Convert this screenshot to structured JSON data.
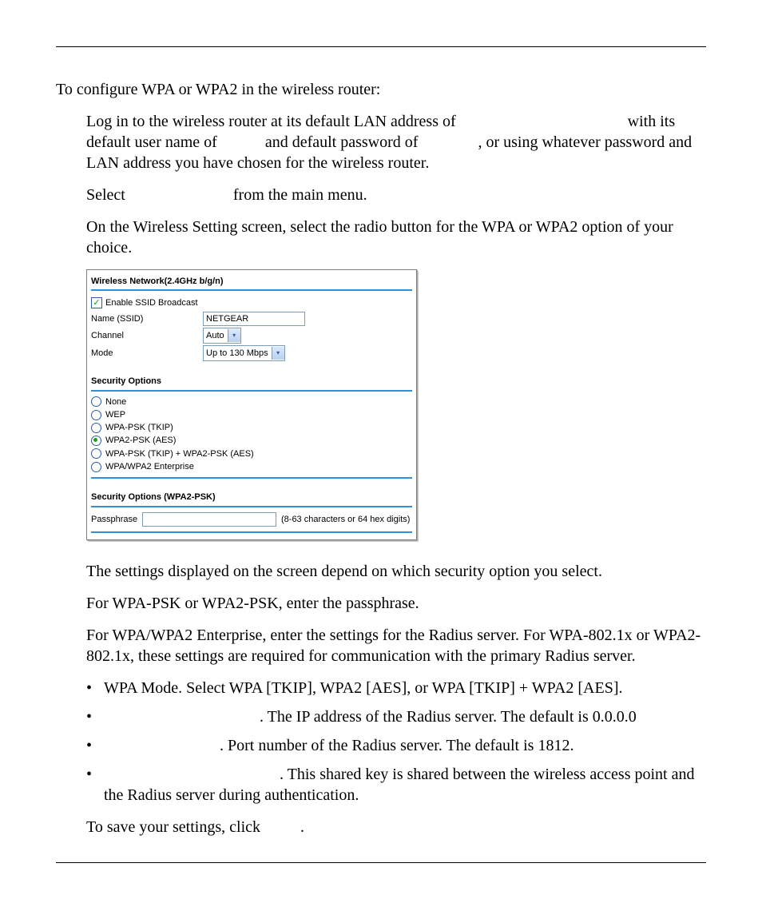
{
  "intro": "To configure WPA or WPA2 in the wireless router:",
  "steps": {
    "s1a": "Log in to the wireless router at its default LAN address of",
    "s1b": "with its default user name of",
    "s1c": "and default password of",
    "s1d": ", or using whatever password and LAN address you have chosen for the wireless router.",
    "s2a": "Select",
    "s2b": "from the main menu.",
    "s3": "On the Wireless Setting screen, select the radio button for the WPA or WPA2 option of your choice."
  },
  "ui": {
    "section1_title": "Wireless Network(2.4GHz b/g/n)",
    "enable_ssid": "Enable SSID Broadcast",
    "name_label": "Name (SSID)",
    "name_value": "NETGEAR",
    "channel_label": "Channel",
    "channel_value": "Auto",
    "mode_label": "Mode",
    "mode_value": "Up to 130 Mbps",
    "security_title": "Security Options",
    "opts": {
      "none": "None",
      "wep": "WEP",
      "wpa_tkip": "WPA-PSK (TKIP)",
      "wpa2_aes": "WPA2-PSK (AES)",
      "both": "WPA-PSK (TKIP) + WPA2-PSK (AES)",
      "enterprise": "WPA/WPA2 Enterprise"
    },
    "section3_title": "Security Options (WPA2-PSK)",
    "passphrase_label": "Passphrase",
    "passphrase_hint": "(8-63 characters or 64 hex digits)"
  },
  "notes": {
    "n1": "The settings displayed on the screen depend on which security option you select.",
    "n2": "For WPA-PSK or WPA2-PSK, enter the passphrase.",
    "n3": "For WPA/WPA2 Enterprise, enter the settings for the Radius server. For WPA-802.1x or WPA2-802.1x, these settings are required for communication with the primary Radius server.",
    "b1": "WPA Mode. Select WPA [TKIP], WPA2 [AES], or WPA [TKIP] + WPA2 [AES].",
    "b2": ". The IP address of the Radius server. The default is 0.0.0.0",
    "b3": ". Port number of the Radius server. The default is 1812.",
    "b4": ". This shared key is shared between the wireless access point and the Radius server during authentication.",
    "save_a": "To save your settings, click",
    "save_b": "."
  }
}
